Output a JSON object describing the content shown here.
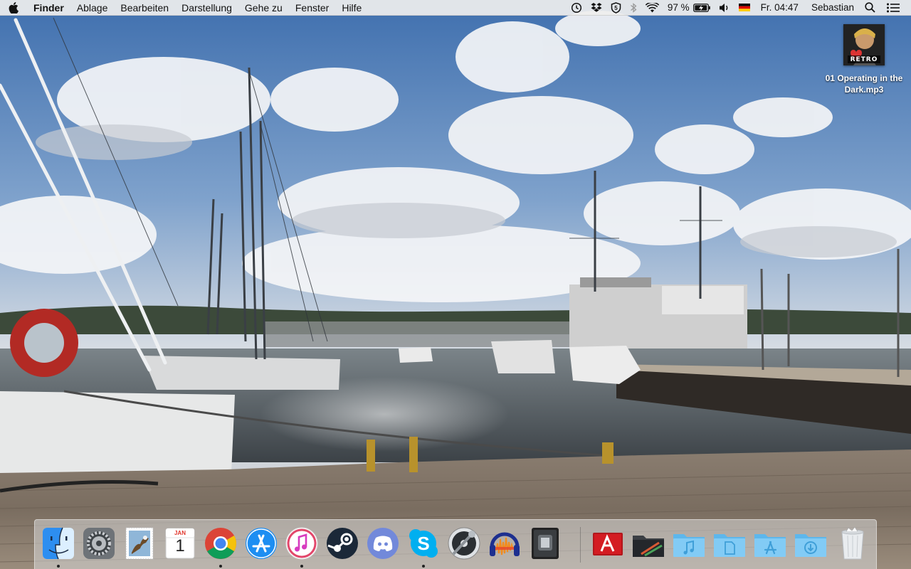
{
  "menubar": {
    "apple_icon": "apple-icon",
    "app_name": "Finder",
    "menus": [
      "Ablage",
      "Bearbeiten",
      "Darstellung",
      "Gehe zu",
      "Fenster",
      "Hilfe"
    ],
    "status": {
      "battery_text": "97 %",
      "battery_level": 0.97,
      "input_flag": "de-flag-icon",
      "clock": "Fr. 04:47",
      "user": "Sebastian"
    }
  },
  "desktop": {
    "file": {
      "label": "01 Operating in the Dark.mp3",
      "thumb_text": "RETRO"
    }
  },
  "dock": {
    "apps": [
      {
        "name": "finder-icon",
        "running": true
      },
      {
        "name": "system-preferences-icon",
        "running": false
      },
      {
        "name": "mail-icon",
        "running": false
      },
      {
        "name": "calendar-icon",
        "running": false,
        "month": "JAN",
        "day": "1"
      },
      {
        "name": "chrome-icon",
        "running": true
      },
      {
        "name": "app-store-icon",
        "running": false
      },
      {
        "name": "itunes-icon",
        "running": true
      },
      {
        "name": "steam-icon",
        "running": false
      },
      {
        "name": "discord-icon",
        "running": false
      },
      {
        "name": "skype-icon",
        "running": true
      },
      {
        "name": "logic-remote-icon",
        "running": false
      },
      {
        "name": "audacity-icon",
        "running": false
      },
      {
        "name": "logic-pro-icon",
        "running": false
      }
    ],
    "folders": [
      "adobe-icon",
      "stack-folder-icon",
      "music-folder-icon",
      "documents-folder-icon",
      "applications-folder-icon",
      "downloads-folder-icon",
      "trash-icon"
    ]
  }
}
